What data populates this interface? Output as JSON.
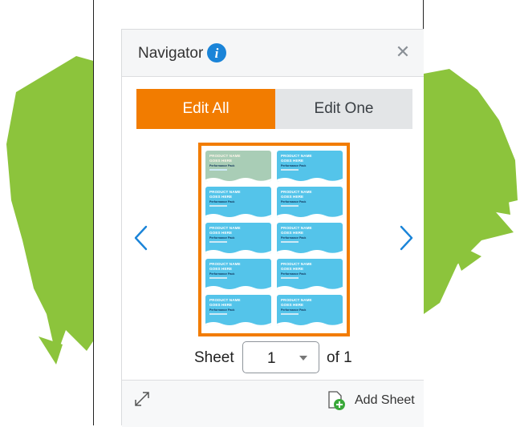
{
  "navigator": {
    "title": "Navigator",
    "info_icon": "info-icon",
    "close_icon": "close-icon"
  },
  "tabs": {
    "edit_all": "Edit All",
    "edit_one": "Edit One",
    "active": "Edit All"
  },
  "colors": {
    "accent": "#f27c00",
    "label_blue": "#54c4ea",
    "label_selected": "#a9cdb6",
    "info_blue": "#1a84d8",
    "splash_green": "#8cc43c"
  },
  "sheet_preview": {
    "labels": [
      {
        "line1": "PRODUCT NAME",
        "line2": "GOES HERE",
        "line3": "Performance Pack"
      },
      {
        "line1": "PRODUCT NAME",
        "line2": "GOES HERE",
        "line3": "Performance Pack"
      },
      {
        "line1": "PRODUCT NAME",
        "line2": "GOES HERE",
        "line3": "Performance Pack"
      },
      {
        "line1": "PRODUCT NAME",
        "line2": "GOES HERE",
        "line3": "Performance Pack"
      },
      {
        "line1": "PRODUCT NAME",
        "line2": "GOES HERE",
        "line3": "Performance Pack"
      },
      {
        "line1": "PRODUCT NAME",
        "line2": "GOES HERE",
        "line3": "Performance Pack"
      },
      {
        "line1": "PRODUCT NAME",
        "line2": "GOES HERE",
        "line3": "Performance Pack"
      },
      {
        "line1": "PRODUCT NAME",
        "line2": "GOES HERE",
        "line3": "Performance Pack"
      },
      {
        "line1": "PRODUCT NAME",
        "line2": "GOES HERE",
        "line3": "Performance Pack"
      },
      {
        "line1": "PRODUCT NAME",
        "line2": "GOES HERE",
        "line3": "Performance Pack"
      }
    ]
  },
  "sheet_selector": {
    "label": "Sheet",
    "value": "1",
    "of_text": "of 1"
  },
  "footer": {
    "expand_icon": "expand-arrows-icon",
    "add_sheet_label": "Add Sheet",
    "add_sheet_icon": "add-sheet-icon"
  }
}
